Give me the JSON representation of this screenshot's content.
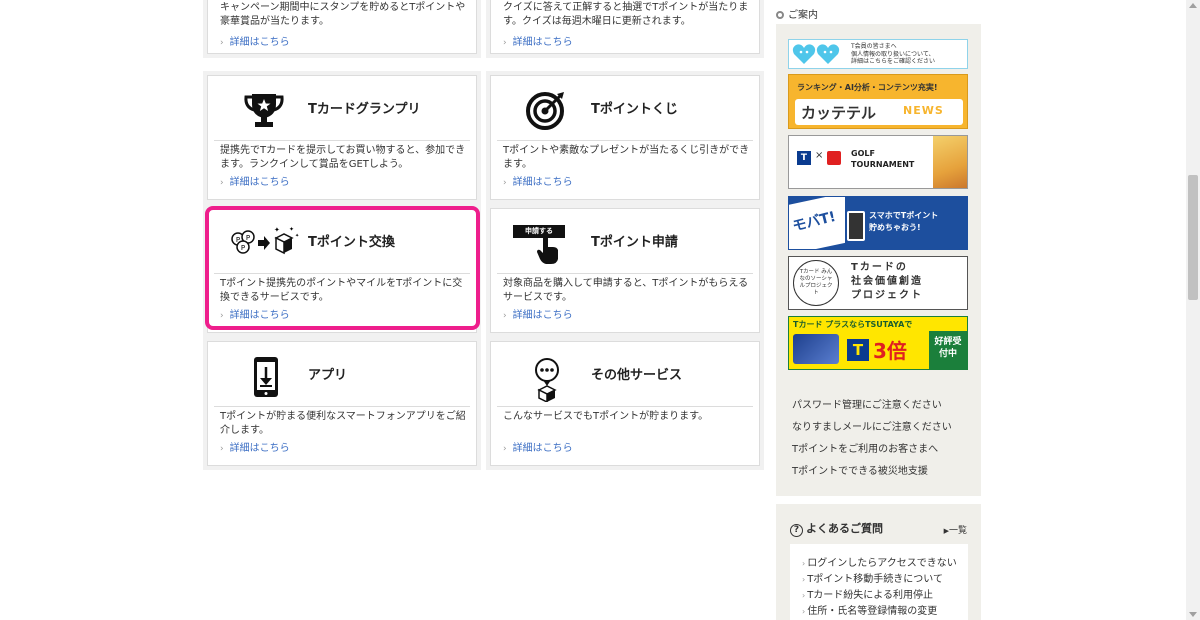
{
  "link_label": "詳細はこちら",
  "top_cards": [
    {
      "desc": "キャンペーン期間中にスタンプを貯めるとTポイントや豪華賞品が当たります。"
    },
    {
      "desc": "クイズに答えて正解すると抽選でTポイントが当たります。クイズは毎週木曜日に更新されます。"
    }
  ],
  "cards": [
    {
      "title": "Tカードグランプリ",
      "icon": "trophy-icon",
      "desc": "提携先でTカードを提示してお買い物すると、参加できます。ランクインして賞品をGETしよう。"
    },
    {
      "title": "Tポイントくじ",
      "icon": "target-icon",
      "desc": "Tポイントや素敵なプレゼントが当たるくじ引きができます。"
    },
    {
      "title": "Tポイント交換",
      "icon": "exchange-icon",
      "desc": "Tポイント提携先のポイントやマイルをTポイントに交換できるサービスです。"
    },
    {
      "title": "Tポイント申請",
      "icon": "apply-button-icon",
      "icon_text": "申請する",
      "desc": "対象商品を購入して申請すると、Tポイントがもらえるサービスです。"
    },
    {
      "title": "アプリ",
      "icon": "smartphone-icon",
      "desc": "Tポイントが貯まる便利なスマートフォンアプリをご紹介します。"
    },
    {
      "title": "その他サービス",
      "icon": "other-services-icon",
      "desc": "こんなサービスでもTポイントが貯まります。"
    }
  ],
  "highlight_color": "#ee1e8c",
  "sidebar": {
    "heading": "ご案内",
    "banners": {
      "privacy": {
        "line1": "T会員の皆さまへ",
        "line2": "個人情報の取り扱いについて、",
        "line3": "詳細はこちらをご確認ください"
      },
      "katteteru": {
        "tagline": "ランキング・AI分析・コンテンツ充実!",
        "name": "カッテテル",
        "news": "NEWS"
      },
      "golf": {
        "x": "×",
        "line1": "GOLF",
        "line2": "TOURNAMENT"
      },
      "mobile": {
        "mobat": "モバT!",
        "line1": "スマホでTポイント",
        "line2": "貯めちゃおう!"
      },
      "social": {
        "badge": "Tカード みんなのソーシャルプロジェクト",
        "line1": "Tカードの",
        "line2": "社会価値創造",
        "line3": "プロジェクト"
      },
      "tsutaya": {
        "headline": "Tカード プラスならTSUTAYAで",
        "t": "T",
        "bai": "3倍",
        "status": "好評受付中"
      }
    },
    "links": [
      "パスワード管理にご注意ください",
      "なりすましメールにご注意ください",
      "Tポイントをご利用のお客さまへ",
      "Tポイントでできる被災地支援"
    ]
  },
  "faq": {
    "icon_text": "?",
    "title": "よくあるご質問",
    "all_link": "一覧",
    "items": [
      "ログインしたらアクセスできない",
      "Tポイント移動手続きについて",
      "Tカード紛失による利用停止",
      "住所・氏名等登録情報の変更"
    ]
  }
}
